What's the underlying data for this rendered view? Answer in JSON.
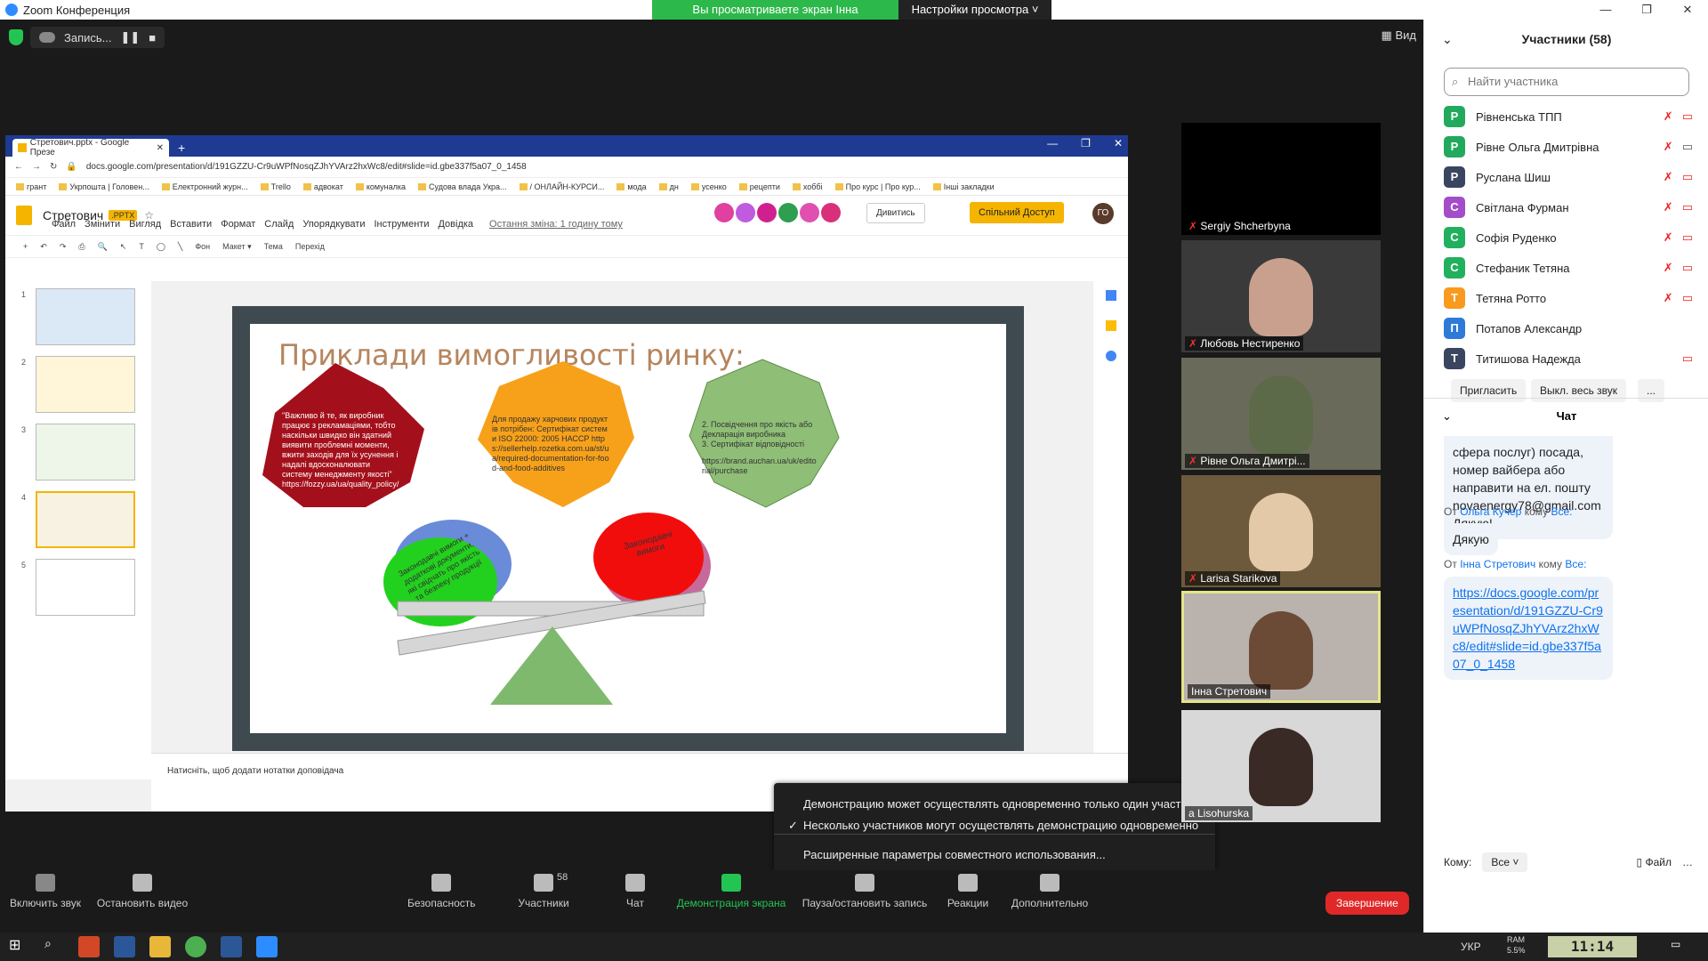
{
  "window": {
    "title": "Zoom Конференция",
    "share_banner": "Вы просматриваете экран Інна Стретович",
    "view_settings": "Настройки просмотра ˅",
    "min": "—",
    "max": "❐",
    "close": "✕"
  },
  "meeting": {
    "recording_label": "Запись...",
    "view_label": "Вид"
  },
  "browser": {
    "tab_title": "Стретович.pptx - Google Презе",
    "url": "docs.google.com/presentation/d/191GZZU-Cr9uWPfNosqZJhYVArz2hxWc8/edit#slide=id.gbe337f5a07_0_1458",
    "bookmarks": [
      "грант",
      "Укрпошта | Головен...",
      "Електронний журн...",
      "Trello",
      "адвокат",
      "комуналка",
      "Судова влада Укра...",
      "/ ОНЛАЙН-КУРСИ...",
      "мода",
      "дн",
      "усенко",
      "рецепти",
      "хоббі",
      "Про курс | Про кур...",
      "Інші закладки"
    ],
    "doc_title": "Стретович",
    "doc_ext": ".PPTX",
    "menu": [
      "Файл",
      "Змінити",
      "Вигляд",
      "Вставити",
      "Формат",
      "Слайд",
      "Упорядкувати",
      "Інструменти",
      "Довідка"
    ],
    "last_edit": "Остання зміна: 1 годину тому",
    "present": "Дивитись",
    "share": "Спільний Доступ",
    "user_initials": "ГО",
    "toolbar": [
      "Фон",
      "Макет ▾",
      "Тема",
      "Перехід"
    ],
    "notes_placeholder": "Натисніть, щоб додати нотатки доповідача",
    "thumb_numbers": [
      "1",
      "2",
      "3",
      "4",
      "5"
    ]
  },
  "slide": {
    "title": "Приклади вимогливості ринку:",
    "hex1": "\"Важливо й те, як виробник працює з рекламаціями, тобто наскільки швидко він здатний виявити проблемні моменти, вжити заходів для їх усунення і надалі вдосконалювати систему менеджменту якості\" https://fozzy.ua/ua/quality_policy/",
    "hex2": "Для продажу харчових продуктів потрібен: Сертифікат системи ISO 22000: 2005 НАССР https://sellerhelp.rozetka.com.ua/st/ua/required-documentation-for-food-and-food-additives",
    "hex3_a": "2. Посвідчення про якість або Декларація виробника",
    "hex3_b": "3. Сертифікат відповідності",
    "hex3_c": "https://brand.auchan.ua/uk/editorial/purchase",
    "left_weight": "Законодавчі вимоги + додаткові документи, які свідчать про якість та безпеку продукції",
    "right_weight": "Законодавчі вимоги"
  },
  "share_menu": {
    "opt1": "Демонстрацию может осуществлять одновременно только один участник",
    "opt2": "Несколько участников могут осуществлять демонстрацию одновременно",
    "opt3": "Расширенные параметры совместного использования...",
    "check": "✓"
  },
  "videos": [
    {
      "name": "Sergiy Shcherbyna"
    },
    {
      "name": "Любовь Нестиренко"
    },
    {
      "name": "Рівне Ольга Дмитрі..."
    },
    {
      "name": "Larisa Starikova"
    },
    {
      "name": "Інна Стретович"
    },
    {
      "name": "a Lisohurska"
    }
  ],
  "toolbar": {
    "mute": "Включить звук",
    "video": "Остановить видео",
    "security": "Безопасность",
    "participants": "Участники",
    "participants_count": "58",
    "chat": "Чат",
    "share": "Демонстрация экрана",
    "record": "Пауза/остановить запись",
    "reactions": "Реакции",
    "more": "Дополнительно",
    "end": "Завершение"
  },
  "participants_panel": {
    "title": "Участники (58)",
    "search_placeholder": "Найти участника",
    "list": [
      {
        "initial": "Р",
        "name": "Рівненська ТПП",
        "color": "#23a95e"
      },
      {
        "initial": "Р",
        "name": "Рівне Ольга Дмитрівна",
        "color": "#23a95e"
      },
      {
        "initial": "Р",
        "name": "Руслана Шиш",
        "color": "#3a4660"
      },
      {
        "initial": "С",
        "name": "Світлана Фурман",
        "color": "#a34dc9"
      },
      {
        "initial": "С",
        "name": "Софія Руденко",
        "color": "#23b05e"
      },
      {
        "initial": "С",
        "name": "Стефаник Тетяна",
        "color": "#23b05e"
      },
      {
        "initial": "Т",
        "name": "Тетяна Ротто",
        "color": "#f79a1e"
      },
      {
        "initial": "П",
        "name": "Потапов Александр",
        "color": "#2f7ad9"
      },
      {
        "initial": "Т",
        "name": "Титишова Надежда",
        "color": "#3a4660"
      }
    ],
    "invite": "Пригласить",
    "mute_all": "Выкл. весь звук",
    "more": "..."
  },
  "chat": {
    "title": "Чат",
    "msg1": "сфера послуг) посада, номер вайбера або направити на ел. пошту novaenergy78@gmail.com Дякую!",
    "from1_prefix": "От",
    "from1_name": "Ольга Кучер",
    "from_mid": "кому",
    "to_all": "Все:",
    "msg2": "Дякую",
    "from2_name": "Інна Стретович",
    "msg3": "https://docs.google.com/presentation/d/191GZZU-Cr9uWPfNosqZJhYVArz2hxWc8/edit#slide=id.gbe337f5a07_0_1458",
    "to_label": "Кому:",
    "to_value": "Все",
    "file": "Файл"
  },
  "taskbar": {
    "lang": "УКР",
    "ram": "RAM",
    "ram_val": "5.5%",
    "clock": "11:14"
  }
}
